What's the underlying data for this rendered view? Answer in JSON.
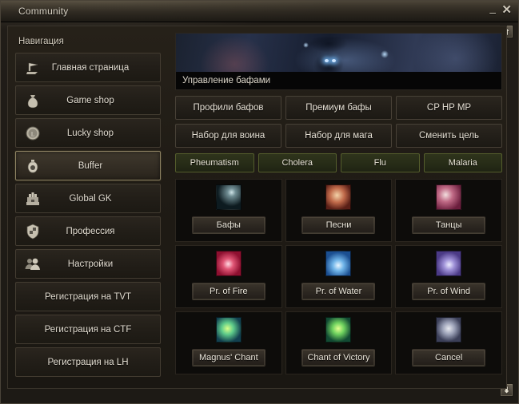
{
  "window": {
    "title": "Community",
    "minimize_label": "–",
    "close_label": "✕",
    "scroll_up_name": "scroll-up-arrow",
    "scroll_down_name": "scroll-down-arrow"
  },
  "sidebar": {
    "heading": "Навигация",
    "items": [
      {
        "label": "Главная страница",
        "icon": "flag-icon",
        "active": false
      },
      {
        "label": "Game shop",
        "icon": "money-bag-icon",
        "active": false
      },
      {
        "label": "Lucky shop",
        "icon": "coin-icon",
        "active": false
      },
      {
        "label": "Buffer",
        "icon": "potion-icon",
        "active": true
      },
      {
        "label": "Global GK",
        "icon": "gate-icon",
        "active": false
      },
      {
        "label": "Профессия",
        "icon": "shield-icon",
        "active": false
      },
      {
        "label": "Настройки",
        "icon": "people-icon",
        "active": false
      },
      {
        "label": "Регистрация на TVT",
        "icon": "",
        "active": false
      },
      {
        "label": "Регистрация на CTF",
        "icon": "",
        "active": false
      },
      {
        "label": "Регистрация на LH",
        "icon": "",
        "active": false
      }
    ]
  },
  "panel": {
    "banner_caption": "Управление бафами",
    "actions": [
      "Профили бафов",
      "Премиум бафы",
      "CP HP MP",
      "Набор для воина",
      "Набор для мага",
      "Сменить цель"
    ],
    "diseases": [
      "Pheumatism",
      "Cholera",
      "Flu",
      "Malaria"
    ],
    "tiles": [
      {
        "label": "Бафы",
        "icon": "buffs-icon"
      },
      {
        "label": "Песни",
        "icon": "songs-icon"
      },
      {
        "label": "Танцы",
        "icon": "dances-icon"
      },
      {
        "label": "Pr. of Fire",
        "icon": "prophecy-fire-icon"
      },
      {
        "label": "Pr. of Water",
        "icon": "prophecy-water-icon"
      },
      {
        "label": "Pr. of Wind",
        "icon": "prophecy-wind-icon"
      },
      {
        "label": "Magnus' Chant",
        "icon": "magnus-chant-icon"
      },
      {
        "label": "Chant of Victory",
        "icon": "chant-of-victory-icon"
      },
      {
        "label": "Cancel",
        "icon": "cancel-icon"
      }
    ]
  },
  "colors": {
    "frame": "#3b352c",
    "panel_bg": "#1f1b15",
    "button_border": "#474036",
    "disease_green": "#545d2c",
    "active_border": "#8d8262",
    "text": "#e6e0d4"
  }
}
